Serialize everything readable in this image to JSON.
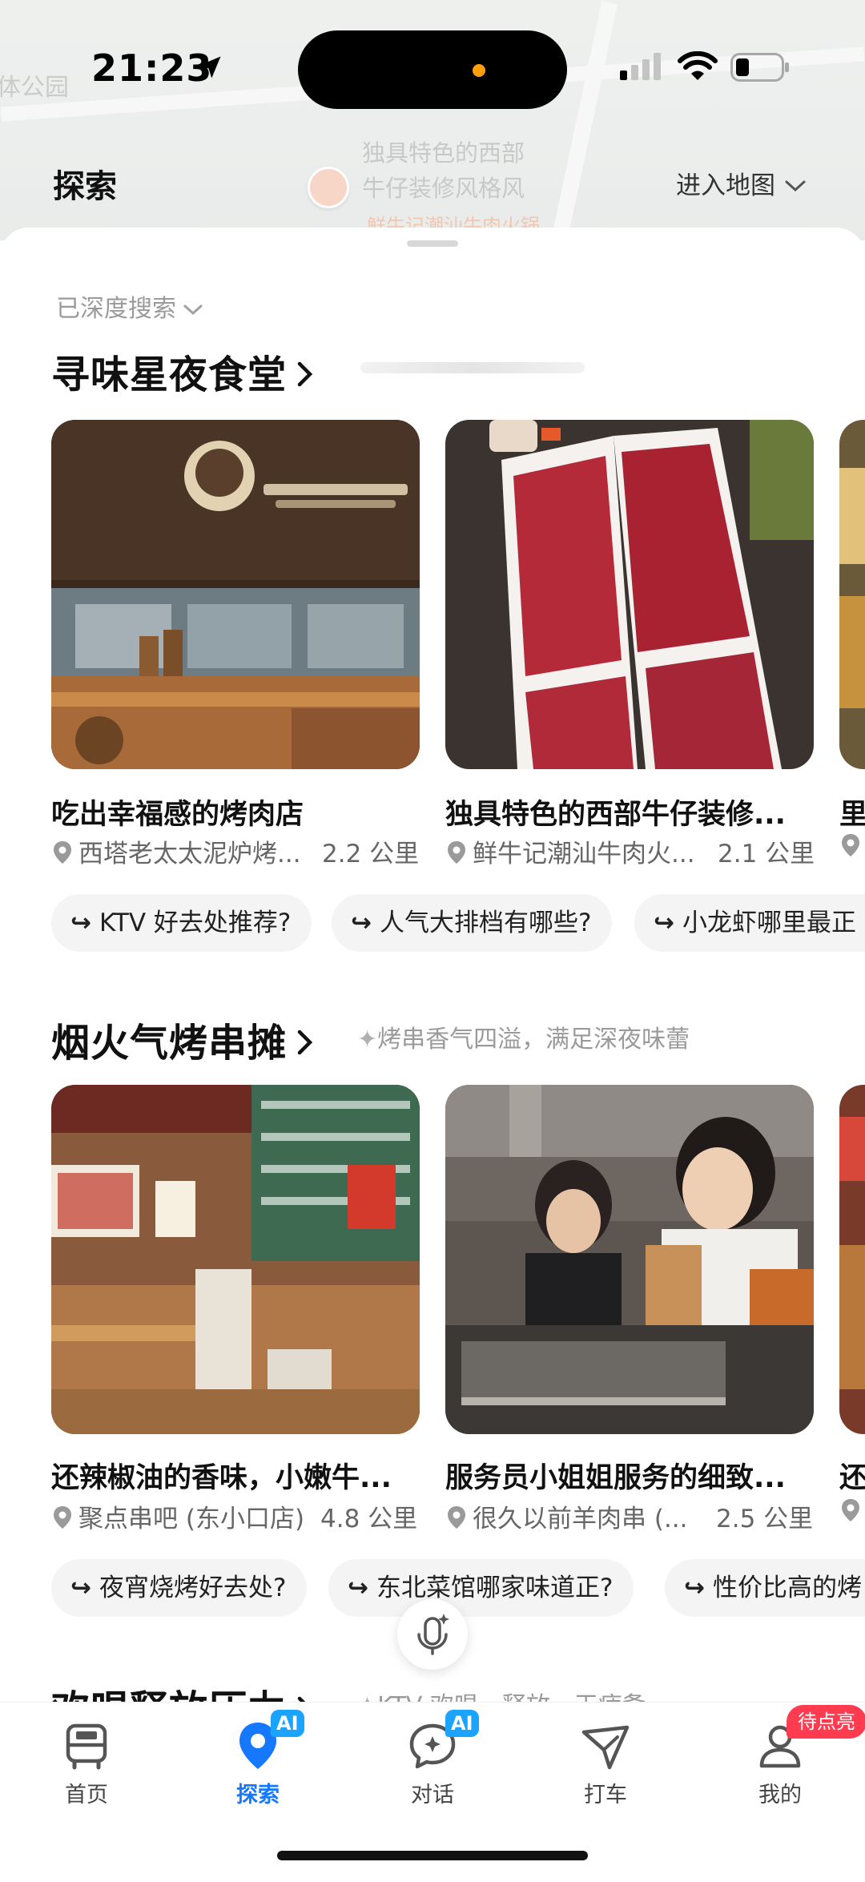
{
  "status_bar": {
    "time": "21:23"
  },
  "map": {
    "poi_title_line1": "独具特色的西部",
    "poi_title_line2": "牛仔装修风格风",
    "poi_sub": "鲜牛记潮汕牛肉火锅",
    "edge_label": "体公园"
  },
  "header": {
    "title": "探索",
    "enter_map": "进入地图"
  },
  "sheet": {
    "deep_search": "已深度搜索"
  },
  "sections": [
    {
      "title": "寻味星夜食堂",
      "subtitle": "",
      "cards": [
        {
          "title": "吃出幸福感的烤肉店",
          "place": "西塔老太太泥炉烤...",
          "distance": "2.2 公里"
        },
        {
          "title": "独具特色的西部牛仔装修...",
          "place": "鲜牛记潮汕牛肉火...",
          "distance": "2.1 公里"
        },
        {
          "title": "里",
          "place": "",
          "distance": ""
        }
      ],
      "chips": [
        "KTV 好去处推荐?",
        "人气大排档有哪些?",
        "小龙虾哪里最正"
      ]
    },
    {
      "title": "烟火气烤串摊",
      "subtitle": "烤串香气四溢，满足深夜味蕾",
      "cards": [
        {
          "title": "还辣椒油的香味，小嫩牛...",
          "place": "聚点串吧 (东小口店)",
          "distance": "4.8 公里"
        },
        {
          "title": "服务员小姐姐服务的细致...",
          "place": "很久以前羊肉串 (...",
          "distance": "2.5 公里"
        },
        {
          "title": "还",
          "place": "",
          "distance": ""
        }
      ],
      "chips": [
        "夜宵烧烤好去处?",
        "东北菜馆哪家味道正?",
        "性价比高的烤"
      ]
    },
    {
      "title": "欢唱释放压力",
      "subtitle": "KTV 欢唱，释放一天疲惫",
      "cards": [],
      "chips": []
    }
  ],
  "nav": {
    "items": [
      {
        "label": "首页",
        "icon": "bus-icon",
        "active": false
      },
      {
        "label": "探索",
        "icon": "explore-pin-icon",
        "active": true,
        "badge": "AI"
      },
      {
        "label": "对话",
        "icon": "chat-bubble-icon",
        "active": false,
        "badge": "AI"
      },
      {
        "label": "打车",
        "icon": "ride-arrow-icon",
        "active": false
      },
      {
        "label": "我的",
        "icon": "profile-icon",
        "active": false
      }
    ],
    "pending_badge": "待点亮"
  },
  "colors": {
    "accent": "#1677ff",
    "badge_blue": "#1aa3ff",
    "badge_red": "#ff3b4f"
  }
}
